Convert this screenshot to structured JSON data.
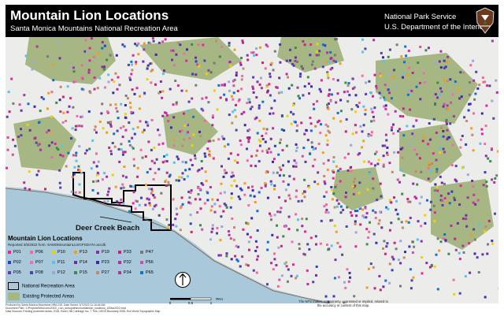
{
  "header": {
    "title": "Mountain Lion Locations",
    "subtitle": "Santa Monica Mountains National Recreation Area",
    "agency_line1": "National Park Service",
    "agency_line2": "U.S. Department of the Interior"
  },
  "map": {
    "place_label": "Deer Creek Beach",
    "colors": {
      "ocean": "#a9c9db",
      "land": "#ececea",
      "protected": "#a7b784",
      "nra_border": "#000000"
    }
  },
  "legend": {
    "title": "Mountain Lion Locations",
    "subtitle": "Reported 3/5/2022 from: SAMOMountainLionGPSDATA.accdb",
    "items": [
      {
        "label": "P01",
        "color": "#e3279b"
      },
      {
        "label": "P06",
        "color": "#f06aa0"
      },
      {
        "label": "P10",
        "color": "#f2d100"
      },
      {
        "label": "P13",
        "color": "#f59c1a"
      },
      {
        "label": "P19",
        "color": "#8d2fa8"
      },
      {
        "label": "P33",
        "color": "#c1267a"
      },
      {
        "label": "P47",
        "color": "#7a7a7a"
      },
      {
        "label": "P02",
        "color": "#2f3fbf"
      },
      {
        "label": "P07",
        "color": "#e86fb8"
      },
      {
        "label": "P11",
        "color": "#56c3e8"
      },
      {
        "label": "P14",
        "color": "#6b2fa0"
      },
      {
        "label": "P23",
        "color": "#3b2aa8"
      },
      {
        "label": "P32",
        "color": "#b52ba5"
      },
      {
        "label": "P56",
        "color": "#d04fa5"
      },
      {
        "label": "P05",
        "color": "#5a3db5"
      },
      {
        "label": "P08",
        "color": "#4a4a9a"
      },
      {
        "label": "P12",
        "color": "#9aa9d9"
      },
      {
        "label": "P15",
        "color": "#3c8a4c"
      },
      {
        "label": "P27",
        "color": "#c28a6a"
      },
      {
        "label": "P34",
        "color": "#a63a9c"
      },
      {
        "label": "P65",
        "color": "#0e74c9"
      }
    ],
    "nra_label": "National Recreation Area",
    "epa_label": "Existing Protected Areas"
  },
  "scale_bar": {
    "ticks": [
      "0",
      "0.5",
      "1"
    ],
    "unit": "Miles"
  },
  "north_arrow": {
    "icon": "north-arrow-icon"
  },
  "disclaimer": "The NPS makes no warranty, expressed or implied, related to the accuracy or content of this map.",
  "footer_lines": [
    "Produced by Santa Monica Mountains NRA GIS, Date Saved: 3/7/2022 11:16:46 AM",
    "Document Path: J:\\Projects\\MtnLions\\2022\\_Lion_andopaths\\mountainlion_locations_10Mar2022.mxd",
    "Data Sources: Existing protected areas; 2018, Esriel, NB Carthage Inc, 7 Thls, USGS Boundary 2008, Esri World Topographic Map"
  ]
}
